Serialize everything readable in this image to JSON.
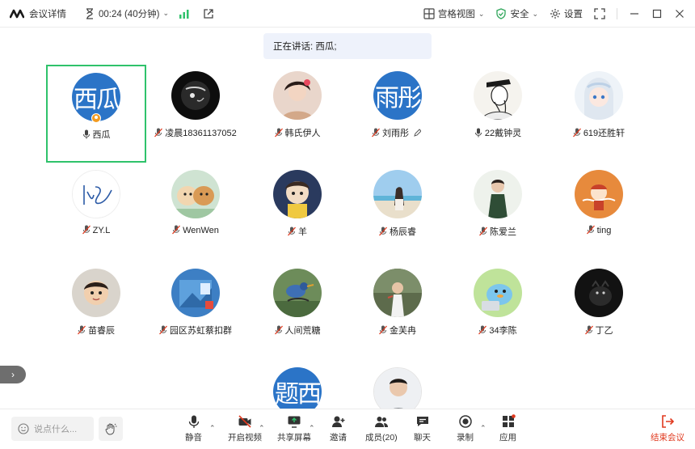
{
  "topbar": {
    "meeting_details": "会议详情",
    "timer": "00:24 (40分钟)",
    "gallery_view": "宫格视图",
    "security": "安全",
    "settings": "设置"
  },
  "speaking_banner": "正在讲话: 西瓜;",
  "participants": [
    {
      "name": "西瓜",
      "avatar_text": "西瓜",
      "avatar": "text",
      "muted": false,
      "host": true,
      "active": true
    },
    {
      "name": "凌晨18361137052",
      "avatar": "dark",
      "muted": true
    },
    {
      "name": "韩氏伊人",
      "avatar": "photo-woman",
      "muted": true
    },
    {
      "name": "刘雨彤",
      "avatar_text": "雨彤",
      "avatar": "text",
      "muted": true,
      "editing": true
    },
    {
      "name": "22戴钟灵",
      "avatar": "ink-figure",
      "muted": false
    },
    {
      "name": "619还胜轩",
      "avatar": "anime",
      "muted": true
    },
    {
      "name": "ZY.L",
      "avatar": "signature",
      "muted": true
    },
    {
      "name": "WenWen",
      "avatar": "dogs",
      "muted": true
    },
    {
      "name": "羊",
      "avatar": "cartoon-kid",
      "muted": true
    },
    {
      "name": "杨辰睿",
      "avatar": "beach",
      "muted": true
    },
    {
      "name": "陈爱兰",
      "avatar": "photo-woman2",
      "muted": true
    },
    {
      "name": "ting",
      "avatar": "orange-cartoon",
      "muted": true
    },
    {
      "name": "苗睿辰",
      "avatar": "child",
      "muted": true
    },
    {
      "name": "园区苏虹蔡扣群",
      "avatar": "blue-building",
      "muted": true
    },
    {
      "name": "人间荒糖",
      "avatar": "bird",
      "muted": true
    },
    {
      "name": "金芙冉",
      "avatar": "photo-outdoor",
      "muted": true
    },
    {
      "name": "34李陈",
      "avatar": "green-cartoon",
      "muted": true
    },
    {
      "name": "丁乙",
      "avatar": "dark-cat",
      "muted": true
    },
    {
      "name": "",
      "avatar_text": "题西",
      "avatar": "text",
      "partial": true
    },
    {
      "name": "",
      "avatar": "man",
      "partial": true
    }
  ],
  "bottombar": {
    "chat_placeholder": "说点什么...",
    "mute": "静音",
    "video": "开启视频",
    "share": "共享屏幕",
    "invite": "邀请",
    "members": "成员(20)",
    "chat": "聊天",
    "record": "录制",
    "apps": "应用",
    "end": "结束会议"
  },
  "colors": {
    "accent_green": "#2fc26b",
    "avatar_blue": "#2b74c7",
    "end_red": "#e0391e",
    "host_orange": "#f39b20"
  }
}
